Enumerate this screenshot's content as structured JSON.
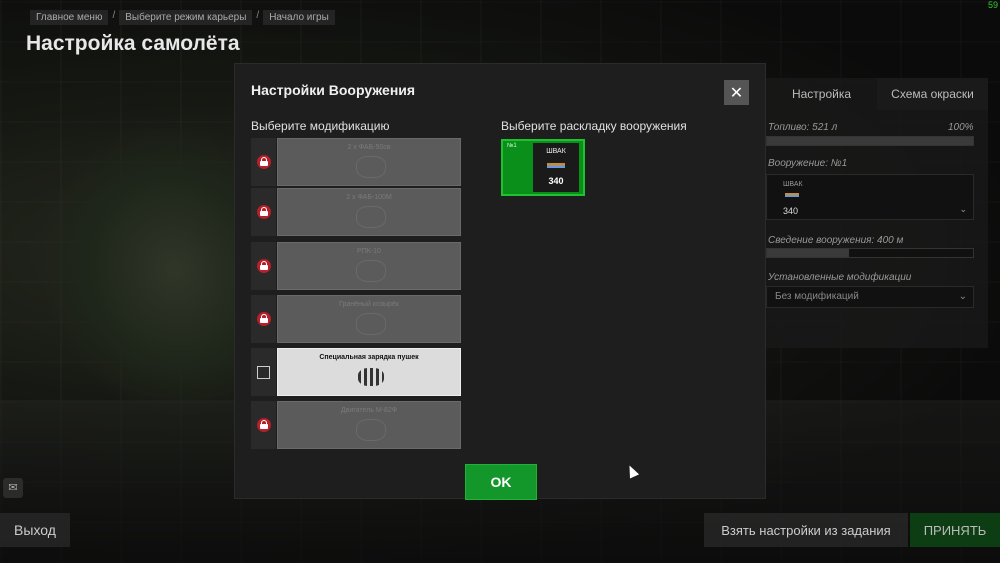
{
  "header": {
    "breadcrumb": [
      "Главное меню",
      "Выберите режим карьеры",
      "Начало игры"
    ],
    "title": "Настройка самолёта",
    "fps": "59"
  },
  "right_panel": {
    "tabs": [
      "Настройка",
      "Схема окраски"
    ],
    "fuel_label": "Топливо: 521 л",
    "fuel_percent": "100%",
    "fuel_fraction": 1.0,
    "armament_label": "Вооружение: №1",
    "armament_gun": "ШВАК",
    "armament_count": "340",
    "convergence_label": "Сведение вооружения: 400 м",
    "convergence_fraction": 0.4,
    "mods_label": "Установленные модификации",
    "mods_value": "Без модификаций"
  },
  "modal": {
    "title": "Настройки Вооружения",
    "close_label": "✕",
    "modifications_heading": "Выберите модификацию",
    "loadout_heading": "Выберите раскладку вооружения",
    "modifications": [
      {
        "name": "2 х ФАБ-50св",
        "locked": true
      },
      {
        "name": "2 х ФАБ-100М",
        "locked": true
      },
      {
        "name": "РПК-10",
        "locked": true
      },
      {
        "name": "Гранёный козырёк",
        "locked": true
      },
      {
        "name": "Специальная зарядка пушек",
        "locked": false
      },
      {
        "name": "Двигатель М-82Ф",
        "locked": true
      }
    ],
    "loadout": {
      "index": "№1",
      "gun": "ШВАК",
      "count": "340"
    },
    "ok_label": "OK"
  },
  "footer": {
    "exit_label": "Выход",
    "mission_label": "Взять настройки из задания",
    "accept_label": "ПРИНЯТЬ"
  },
  "colors": {
    "accent_green": "#13962a",
    "lock_red": "#b5202a"
  }
}
